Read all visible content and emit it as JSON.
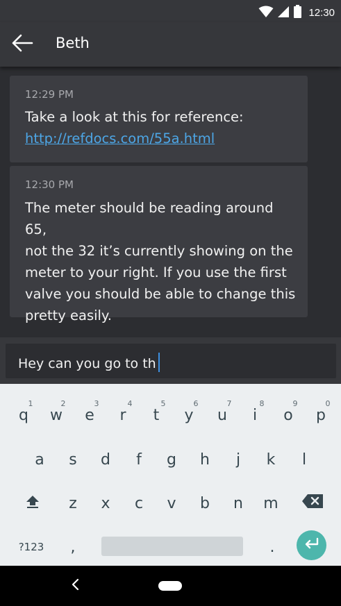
{
  "status_bar": {
    "time": "12:30"
  },
  "header": {
    "contact_name": "Beth"
  },
  "messages": [
    {
      "time": "12:29 PM",
      "text": "Take a look at this for reference:",
      "link": "http://refdocs.com/55a.html"
    },
    {
      "time": "12:30 PM",
      "text_lines": [
        "The meter should be reading around 65,",
        "not the 32 it’s currently showing on the",
        "meter to your right. If you use the first",
        "valve you should be able to change this",
        "pretty easily."
      ]
    }
  ],
  "compose": {
    "value": "Hey can you go to th"
  },
  "keyboard": {
    "row1": [
      {
        "key": "q",
        "hint": "1"
      },
      {
        "key": "w",
        "hint": "2"
      },
      {
        "key": "e",
        "hint": "3"
      },
      {
        "key": "r",
        "hint": "4"
      },
      {
        "key": "t",
        "hint": "5"
      },
      {
        "key": "y",
        "hint": "6"
      },
      {
        "key": "u",
        "hint": "7"
      },
      {
        "key": "i",
        "hint": "8"
      },
      {
        "key": "o",
        "hint": "9"
      },
      {
        "key": "p",
        "hint": "0"
      }
    ],
    "row2": [
      "a",
      "s",
      "d",
      "f",
      "g",
      "h",
      "j",
      "k",
      "l"
    ],
    "row3": [
      "z",
      "x",
      "c",
      "v",
      "b",
      "n",
      "m"
    ],
    "symbols_label": "?123",
    "comma": ",",
    "period": "."
  },
  "icons": {
    "back": "arrow-left-icon",
    "shift": "shift-icon",
    "backspace": "backspace-icon",
    "enter": "enter-icon",
    "wifi": "wifi-icon",
    "cell": "cell-signal-icon",
    "battery": "battery-icon"
  },
  "colors": {
    "accent_link": "#4da6e6",
    "caret": "#3d8fe0",
    "enter_key": "#4db6ac"
  }
}
